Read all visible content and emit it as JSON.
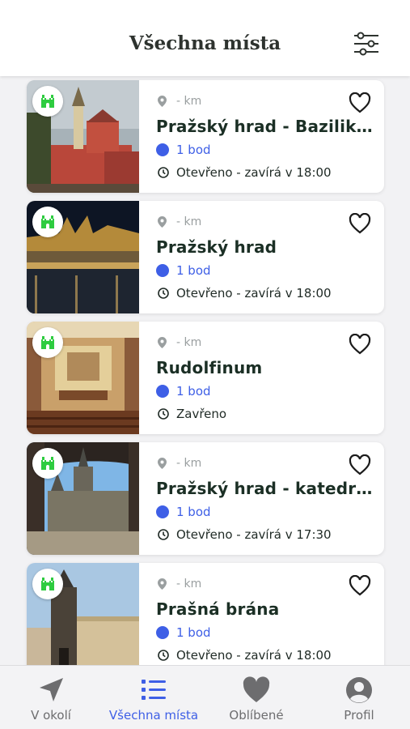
{
  "header": {
    "title": "Všechna místa"
  },
  "places": [
    {
      "distance": "- km",
      "name": "Pražský hrad - Bazilika sv. Jiří",
      "points": "1 bod",
      "hours": "Otevřeno - zavírá v 18:00"
    },
    {
      "distance": "- km",
      "name": "Pražský hrad",
      "points": "1 bod",
      "hours": "Otevřeno - zavírá v 18:00"
    },
    {
      "distance": "- km",
      "name": "Rudolfinum",
      "points": "1 bod",
      "hours": "Zavřeno"
    },
    {
      "distance": "- km",
      "name": "Pražský hrad - katedrála sv. Víta",
      "points": "1 bod",
      "hours": "Otevřeno - zavírá v 17:30"
    },
    {
      "distance": "- km",
      "name": "Prašná brána",
      "points": "1 bod",
      "hours": "Otevřeno - zavírá v 18:00"
    }
  ],
  "tabs": [
    {
      "label": "V okolí",
      "icon": "navigation-arrow-icon",
      "active": false
    },
    {
      "label": "Všechna místa",
      "icon": "list-icon",
      "active": true
    },
    {
      "label": "Oblíbené",
      "icon": "heart-icon",
      "active": false
    },
    {
      "label": "Profil",
      "icon": "user-icon",
      "active": false
    }
  ],
  "colors": {
    "accent": "#3e5fe6",
    "badge_green": "#2ecc40",
    "title_text": "#1b2f25"
  }
}
